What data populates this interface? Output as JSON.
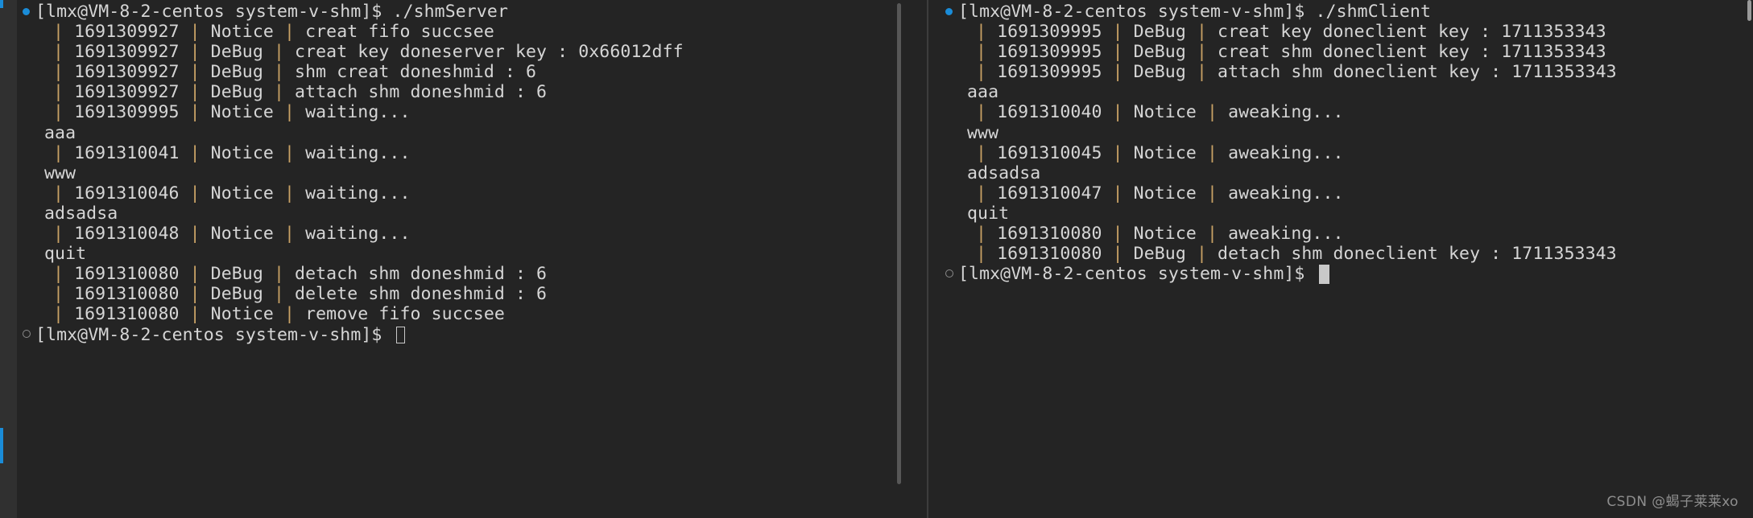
{
  "theme": {
    "background": "#242424",
    "foreground": "#d6d6d6",
    "pipe_color": "#c8a165",
    "accent_blue": "#1a8cd8",
    "gutter": "#303030",
    "divider": "#3d3d3d",
    "watermark_color": "#8e8e8e"
  },
  "watermark": {
    "text": "CSDN @蝎子莱莱xo"
  },
  "left_pane": {
    "name": "shmServer terminal",
    "lines": [
      {
        "kind": "prompt",
        "marker": "running-dot",
        "text": "[lmx@VM-8-2-centos system-v-shm]$ ./shmServer"
      },
      {
        "kind": "log",
        "text": "| 1691309927 | Notice | creat fifo succsee"
      },
      {
        "kind": "log",
        "text": "| 1691309927 | DeBug | creat key doneserver key : 0x66012dff"
      },
      {
        "kind": "log",
        "text": "| 1691309927 | DeBug | shm creat doneshmid : 6"
      },
      {
        "kind": "log",
        "text": "| 1691309927 | DeBug | attach shm doneshmid : 6"
      },
      {
        "kind": "log",
        "text": "| 1691309995 | Notice | waiting..."
      },
      {
        "kind": "echo",
        "text": "aaa"
      },
      {
        "kind": "log",
        "text": "| 1691310041 | Notice | waiting..."
      },
      {
        "kind": "echo",
        "text": "www"
      },
      {
        "kind": "log",
        "text": "| 1691310046 | Notice | waiting..."
      },
      {
        "kind": "echo",
        "text": "adsadsa"
      },
      {
        "kind": "log",
        "text": "| 1691310048 | Notice | waiting..."
      },
      {
        "kind": "echo",
        "text": "quit"
      },
      {
        "kind": "log",
        "text": "| 1691310080 | DeBug | detach shm doneshmid : 6"
      },
      {
        "kind": "log",
        "text": "| 1691310080 | DeBug | delete shm doneshmid : 6"
      },
      {
        "kind": "log",
        "text": "| 1691310080 | Notice | remove fifo succsee"
      },
      {
        "kind": "prompt-cursor-hollow",
        "marker": "idle-dot",
        "text": "[lmx@VM-8-2-centos system-v-shm]$ "
      }
    ]
  },
  "right_pane": {
    "name": "shmClient terminal",
    "lines": [
      {
        "kind": "prompt",
        "marker": "running-dot",
        "text": "[lmx@VM-8-2-centos system-v-shm]$ ./shmClient"
      },
      {
        "kind": "log",
        "text": "| 1691309995 | DeBug | creat key doneclient key : 1711353343"
      },
      {
        "kind": "log",
        "text": "| 1691309995 | DeBug | creat shm doneclient key : 1711353343"
      },
      {
        "kind": "log",
        "text": "| 1691309995 | DeBug | attach shm doneclient key : 1711353343"
      },
      {
        "kind": "echo",
        "text": "aaa"
      },
      {
        "kind": "log",
        "text": "| 1691310040 | Notice | aweaking..."
      },
      {
        "kind": "echo",
        "text": "www"
      },
      {
        "kind": "log",
        "text": "| 1691310045 | Notice | aweaking..."
      },
      {
        "kind": "echo",
        "text": "adsadsa"
      },
      {
        "kind": "log",
        "text": "| 1691310047 | Notice | aweaking..."
      },
      {
        "kind": "echo",
        "text": "quit"
      },
      {
        "kind": "log",
        "text": "| 1691310080 | Notice | aweaking..."
      },
      {
        "kind": "log",
        "text": "| 1691310080 | DeBug | detach shm doneclient key : 1711353343"
      },
      {
        "kind": "prompt-cursor-solid",
        "marker": "idle-dot",
        "text": "[lmx@VM-8-2-centos system-v-shm]$ "
      }
    ]
  }
}
